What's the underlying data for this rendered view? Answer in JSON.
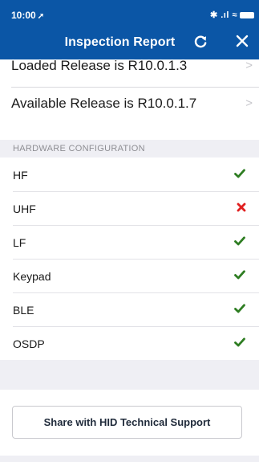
{
  "status_bar": {
    "time": "10:00",
    "icons_text": "✱ .ıl ≈"
  },
  "header": {
    "title": "Inspection Report"
  },
  "release": {
    "loaded_label": "Loaded Release is R10.0.1.3",
    "available_label": "Available Release is R10.0.1.7"
  },
  "hardware": {
    "section_title": "HARDWARE CONFIGURATION",
    "items": [
      {
        "label": "HF",
        "status": "ok"
      },
      {
        "label": "UHF",
        "status": "fail"
      },
      {
        "label": "LF",
        "status": "ok"
      },
      {
        "label": "Keypad",
        "status": "ok"
      },
      {
        "label": "BLE",
        "status": "ok"
      },
      {
        "label": "OSDP",
        "status": "ok"
      }
    ]
  },
  "share": {
    "button_label": "Share with HID Technical Support"
  },
  "colors": {
    "brand": "#0b56a6",
    "ok": "#2e7d22",
    "fail": "#e02020"
  }
}
